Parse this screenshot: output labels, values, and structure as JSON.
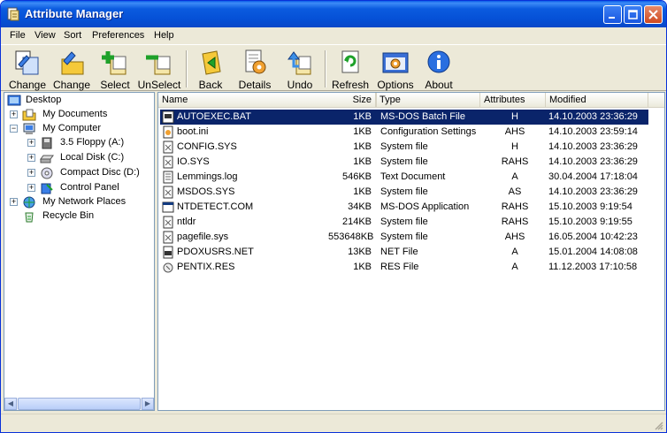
{
  "window": {
    "title": "Attribute Manager"
  },
  "menu": [
    "File",
    "View",
    "Sort",
    "Preferences",
    "Help"
  ],
  "toolbar": {
    "change1": "Change",
    "change2": "Change",
    "select": "Select",
    "unselect": "UnSelect",
    "back": "Back",
    "details": "Details",
    "undo": "Undo",
    "refresh": "Refresh",
    "options": "Options",
    "about": "About"
  },
  "tree": {
    "desktop": "Desktop",
    "my_documents": "My Documents",
    "my_computer": "My Computer",
    "floppy": "3.5 Floppy (A:)",
    "local_disk": "Local Disk (C:)",
    "compact_disc": "Compact Disc (D:)",
    "control_panel": "Control Panel",
    "network": "My Network Places",
    "recycle": "Recycle Bin"
  },
  "columns": {
    "name": "Name",
    "size": "Size",
    "type": "Type",
    "attributes": "Attributes",
    "modified": "Modified"
  },
  "files": [
    {
      "name": "AUTOEXEC.BAT",
      "size": "1KB",
      "type": "MS-DOS Batch File",
      "attr": "H",
      "modified": "14.10.2003 23:36:29"
    },
    {
      "name": "boot.ini",
      "size": "1KB",
      "type": "Configuration Settings",
      "attr": "AHS",
      "modified": "14.10.2003 23:59:14"
    },
    {
      "name": "CONFIG.SYS",
      "size": "1KB",
      "type": "System file",
      "attr": "H",
      "modified": "14.10.2003 23:36:29"
    },
    {
      "name": "IO.SYS",
      "size": "1KB",
      "type": "System file",
      "attr": "RAHS",
      "modified": "14.10.2003 23:36:29"
    },
    {
      "name": "Lemmings.log",
      "size": "546KB",
      "type": "Text Document",
      "attr": "A",
      "modified": "30.04.2004 17:18:04"
    },
    {
      "name": "MSDOS.SYS",
      "size": "1KB",
      "type": "System file",
      "attr": "AS",
      "modified": "14.10.2003 23:36:29"
    },
    {
      "name": "NTDETECT.COM",
      "size": "34KB",
      "type": "MS-DOS Application",
      "attr": "RAHS",
      "modified": "15.10.2003 9:19:54"
    },
    {
      "name": "ntldr",
      "size": "214KB",
      "type": "System file",
      "attr": "RAHS",
      "modified": "15.10.2003 9:19:55"
    },
    {
      "name": "pagefile.sys",
      "size": "553648KB",
      "type": "System file",
      "attr": "AHS",
      "modified": "16.05.2004 10:42:23"
    },
    {
      "name": "PDOXUSRS.NET",
      "size": "13KB",
      "type": "NET File",
      "attr": "A",
      "modified": "15.01.2004 14:08:08"
    },
    {
      "name": "PENTIX.RES",
      "size": "1KB",
      "type": "RES File",
      "attr": "A",
      "modified": "11.12.2003 17:10:58"
    }
  ],
  "colors": {
    "title_blue": "#0550d6",
    "selection": "#0a246a",
    "face": "#ece9d8"
  }
}
